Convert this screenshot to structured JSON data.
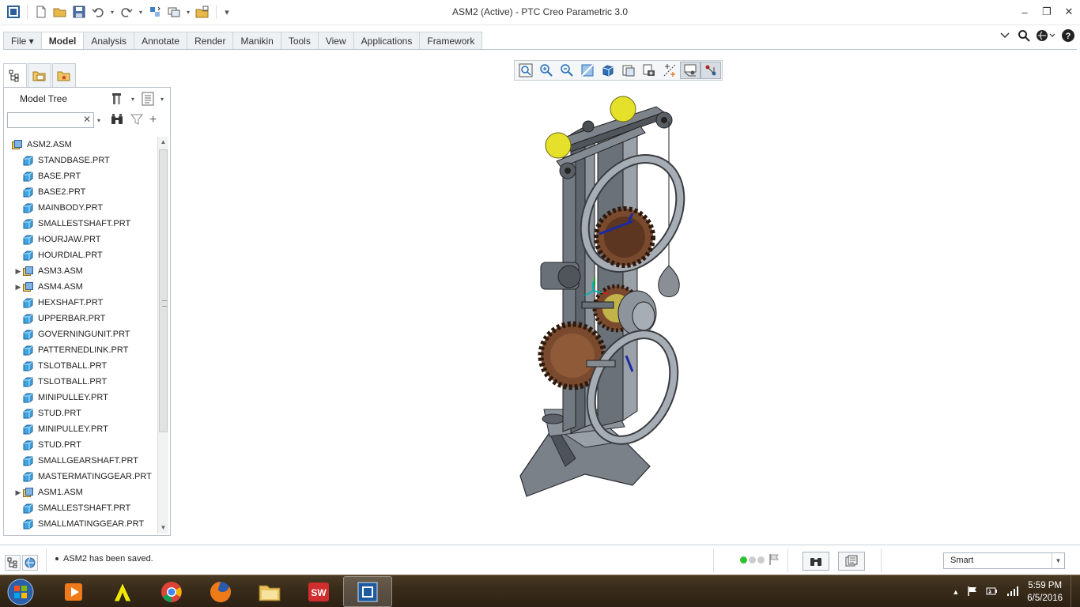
{
  "window": {
    "title": "ASM2 (Active) - PTC Creo Parametric 3.0"
  },
  "quick_access": [
    "new-icon",
    "open-icon",
    "save-icon",
    "undo-icon",
    "redo-icon",
    "regenerate-icon",
    "windows-icon",
    "close-icon",
    "customize-icon"
  ],
  "ribbon": {
    "tabs": [
      {
        "label": "File ▾",
        "active": false
      },
      {
        "label": "Model",
        "active": true
      },
      {
        "label": "Analysis",
        "active": false
      },
      {
        "label": "Annotate",
        "active": false
      },
      {
        "label": "Render",
        "active": false
      },
      {
        "label": "Manikin",
        "active": false
      },
      {
        "label": "Tools",
        "active": false
      },
      {
        "label": "View",
        "active": false
      },
      {
        "label": "Applications",
        "active": false
      },
      {
        "label": "Framework",
        "active": false
      }
    ]
  },
  "navigator": {
    "tabs": [
      "model-tree-tab",
      "folder-browser-tab",
      "favorites-tab"
    ],
    "title": "Model Tree",
    "search_value": "",
    "tree": [
      {
        "label": "ASM2.ASM",
        "type": "asm",
        "expandable": false,
        "root": true
      },
      {
        "label": "STANDBASE.PRT",
        "type": "prt"
      },
      {
        "label": "BASE.PRT",
        "type": "prt"
      },
      {
        "label": "BASE2.PRT",
        "type": "prt"
      },
      {
        "label": "MAINBODY.PRT",
        "type": "prt"
      },
      {
        "label": "SMALLESTSHAFT.PRT",
        "type": "prt"
      },
      {
        "label": "HOURJAW.PRT",
        "type": "prt"
      },
      {
        "label": "HOURDIAL.PRT",
        "type": "prt"
      },
      {
        "label": "ASM3.ASM",
        "type": "asm",
        "expandable": true
      },
      {
        "label": "ASM4.ASM",
        "type": "asm",
        "expandable": true
      },
      {
        "label": "HEXSHAFT.PRT",
        "type": "prt"
      },
      {
        "label": "UPPERBAR.PRT",
        "type": "prt"
      },
      {
        "label": "GOVERNINGUNIT.PRT",
        "type": "prt"
      },
      {
        "label": "PATTERNEDLINK.PRT",
        "type": "prt"
      },
      {
        "label": "TSLOTBALL.PRT",
        "type": "prt"
      },
      {
        "label": "TSLOTBALL.PRT",
        "type": "prt"
      },
      {
        "label": "MINIPULLEY.PRT",
        "type": "prt"
      },
      {
        "label": "STUD.PRT",
        "type": "prt"
      },
      {
        "label": "MINIPULLEY.PRT",
        "type": "prt"
      },
      {
        "label": "STUD.PRT",
        "type": "prt"
      },
      {
        "label": "SMALLGEARSHAFT.PRT",
        "type": "prt"
      },
      {
        "label": "MASTERMATINGGEAR.PRT",
        "type": "prt"
      },
      {
        "label": "ASM1.ASM",
        "type": "asm",
        "expandable": true
      },
      {
        "label": "SMALLESTSHAFT.PRT",
        "type": "prt"
      },
      {
        "label": "SMALLMATINGGEAR.PRT",
        "type": "prt"
      }
    ]
  },
  "graphics_toolbar": [
    "refit-icon",
    "zoom-in-icon",
    "zoom-out-icon",
    "repaint-icon",
    "display-style-icon",
    "saved-orientations-icon",
    "view-manager-icon",
    "datum-display-icon",
    "spin-center-icon",
    "annotation-display-icon"
  ],
  "status": {
    "message": "ASM2 has been saved.",
    "filter_value": "Smart"
  },
  "taskbar": {
    "time": "5:59 PM",
    "date": "6/5/2016",
    "apps": [
      "media-player-icon",
      "autocad-icon",
      "chrome-icon",
      "firefox-icon",
      "file-explorer-icon",
      "solidworks-icon",
      "creo-icon"
    ]
  },
  "colors": {
    "accent": "#3b7fc4",
    "ball": "#e5e02a",
    "gear": "#7a4a2e",
    "frame": "#6e747c"
  }
}
